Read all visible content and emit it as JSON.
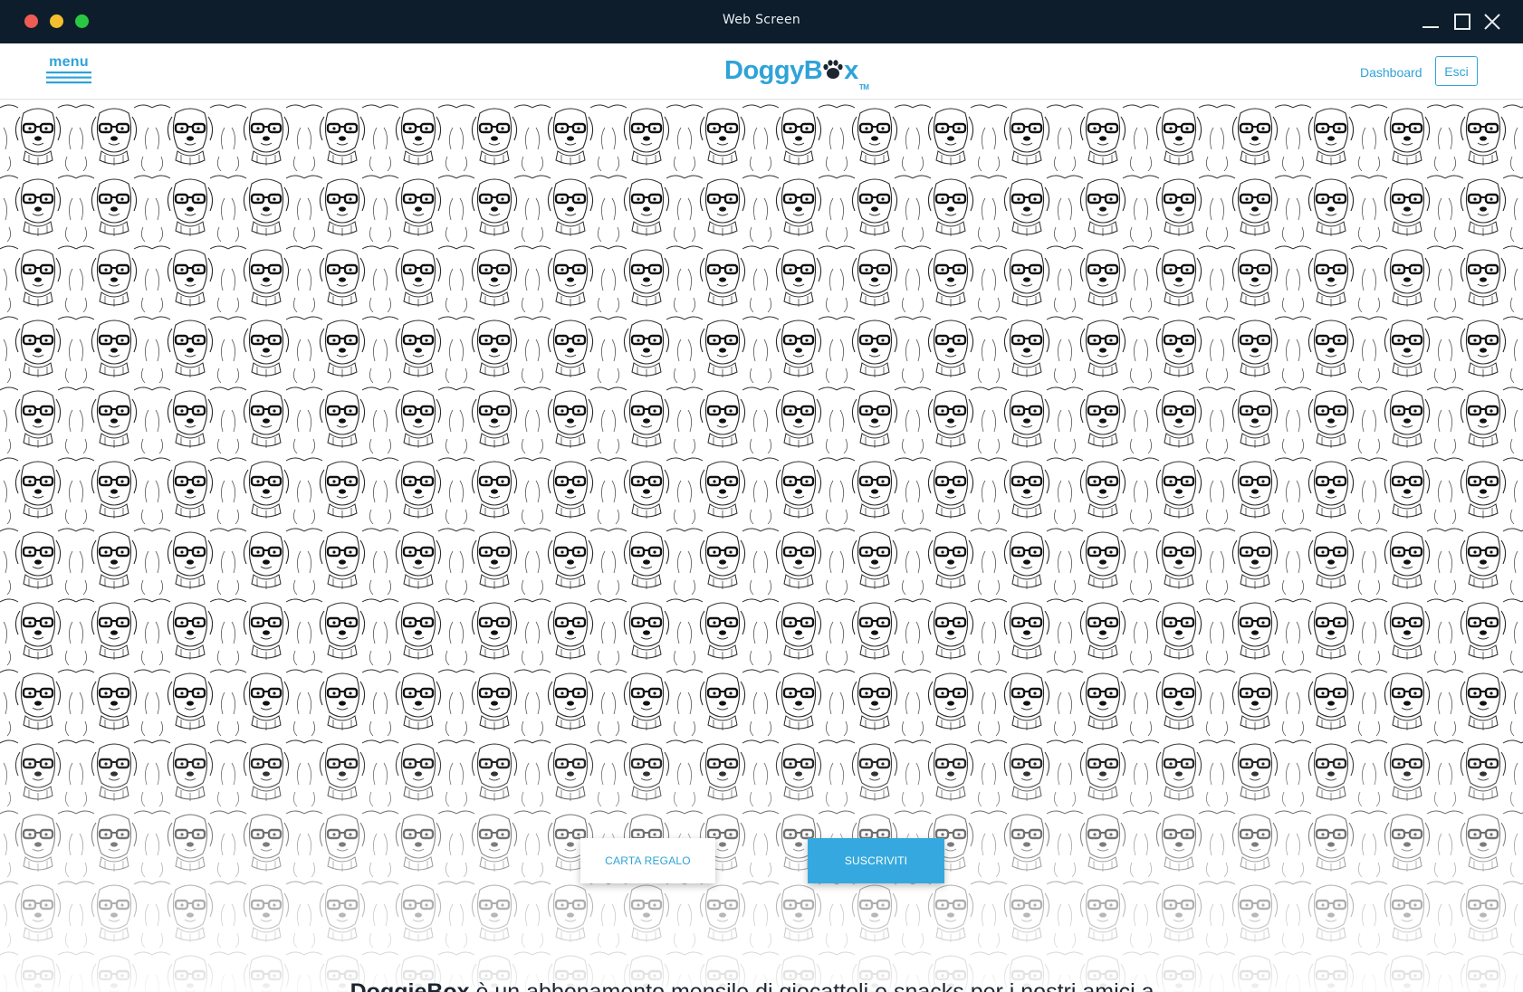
{
  "window": {
    "title": "Web Screen",
    "controls": [
      "minimize-icon",
      "maximize-icon",
      "close-icon"
    ]
  },
  "header": {
    "menu_label": "menu",
    "logo": {
      "text_before": "Doggy",
      "text_b": "B",
      "text_after": "x",
      "tm": "TM"
    },
    "nav": {
      "dashboard": "Dashboard",
      "logout": "Esci"
    }
  },
  "hero": {
    "background": "hipster-dogs-pattern",
    "buttons": {
      "gift_card": "CARTA REGALO",
      "subscribe": "SUSCRIVITI"
    }
  },
  "tagline": {
    "brand": "DoggieBox",
    "text": " è un abbonamento mensile di giocattoli e snacks per i nostri amici a..."
  },
  "colors": {
    "accent": "#2fa3d8",
    "button_primary": "#35a9df",
    "titlebar": "#0d1d2b",
    "text_dark": "#1c2530"
  }
}
